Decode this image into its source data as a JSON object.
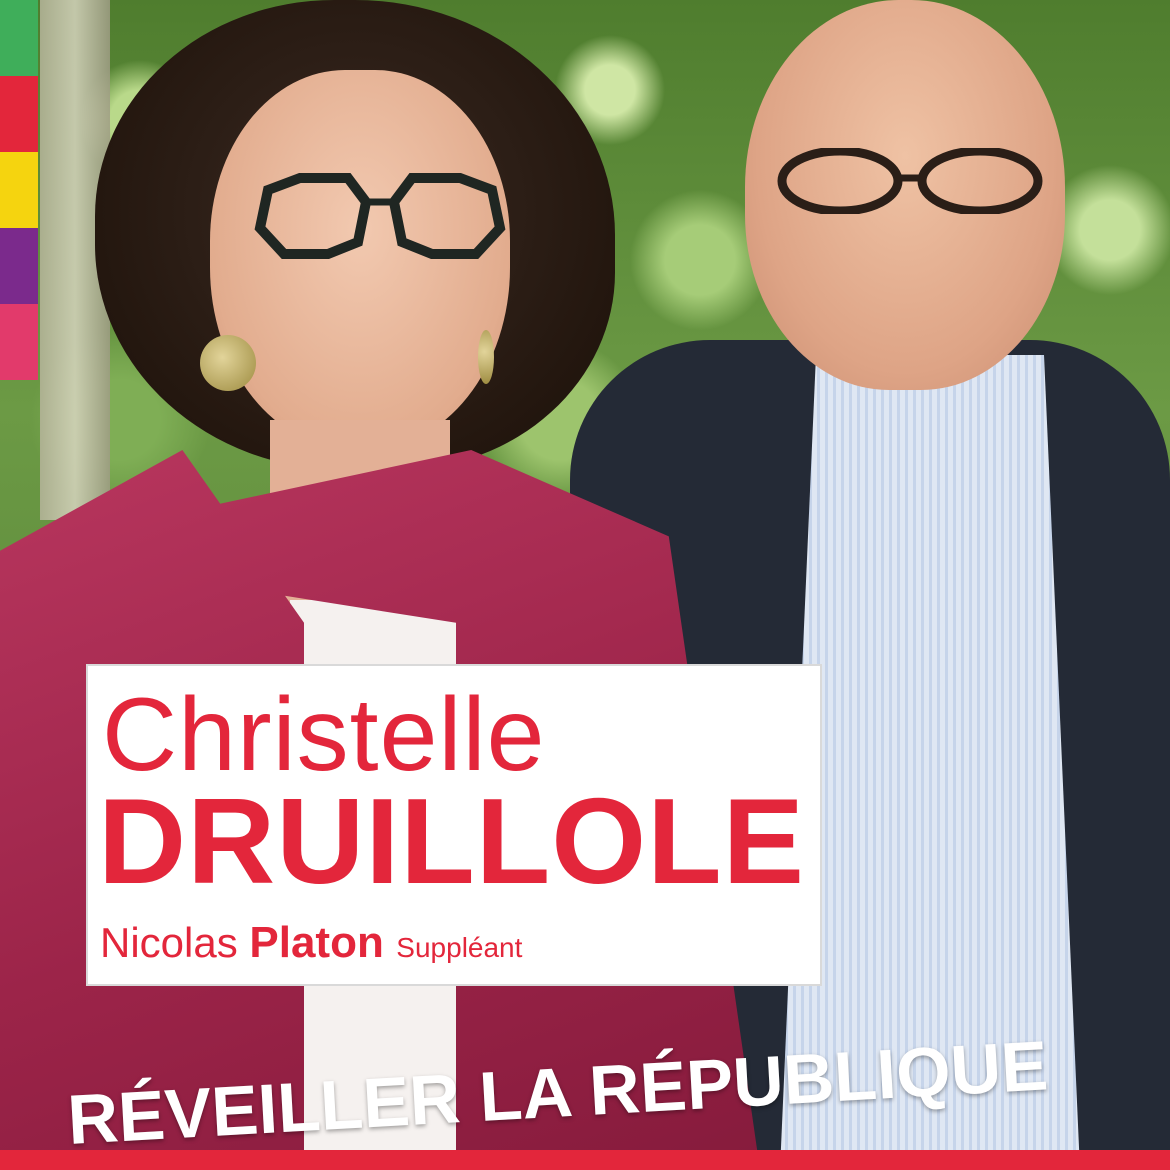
{
  "colors": {
    "accent_red": "#e3263b",
    "stripe": [
      "#3fae5a",
      "#e3263b",
      "#f5d40f",
      "#7b2a8c",
      "#e23a6b"
    ]
  },
  "candidate": {
    "first_name": "Christelle",
    "last_name": "DRUILLOLE"
  },
  "substitute": {
    "first_name": "Nicolas",
    "last_name": "Platon",
    "role": "Suppléant"
  },
  "slogan": "RÉVEILLER LA RÉPUBLIQUE"
}
